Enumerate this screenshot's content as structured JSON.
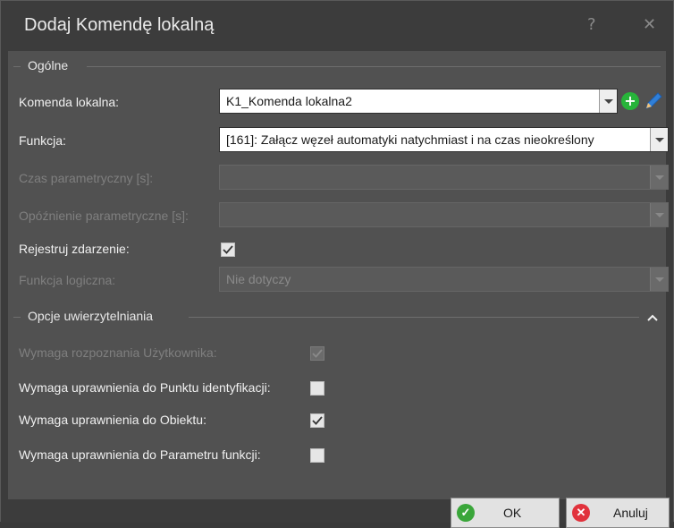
{
  "window": {
    "title": "Dodaj Komendę lokalną",
    "help_label": "?",
    "close_label": "✕"
  },
  "general": {
    "title": "Ogólne",
    "local_command": {
      "label": "Komenda lokalna:",
      "value": "K1_Komenda lokalna2"
    },
    "function": {
      "label": "Funkcja:",
      "value": "[161]: Załącz węzeł automatyki natychmiast i na czas nieokreślony"
    },
    "param_time": {
      "label": "Czas parametryczny [s]:",
      "value": ""
    },
    "param_delay": {
      "label": "Opóźnienie parametryczne [s]:",
      "value": ""
    },
    "register_event": {
      "label": "Rejestruj zdarzenie:",
      "checked": true
    },
    "logic_function": {
      "label": "Funkcja logiczna:",
      "value": "Nie dotyczy"
    }
  },
  "auth": {
    "title": "Opcje uwierzytelniania",
    "collapse_label": "^",
    "require_user": {
      "label": "Wymaga rozpoznania Użytkownika:",
      "checked": true,
      "disabled": true
    },
    "require_id_point": {
      "label": "Wymaga uprawnienia do Punktu identyfikacji:",
      "checked": false
    },
    "require_object": {
      "label": "Wymaga uprawnienia do Obiektu:",
      "checked": true
    },
    "require_param": {
      "label": "Wymaga uprawnienia do Parametru funkcji:",
      "checked": false
    }
  },
  "buttons": {
    "ok": "OK",
    "cancel": "Anuluj"
  },
  "colors": {
    "accent_add": "#27b43a",
    "cancel_red": "#e1323c",
    "ok_green": "#3aa63a"
  }
}
